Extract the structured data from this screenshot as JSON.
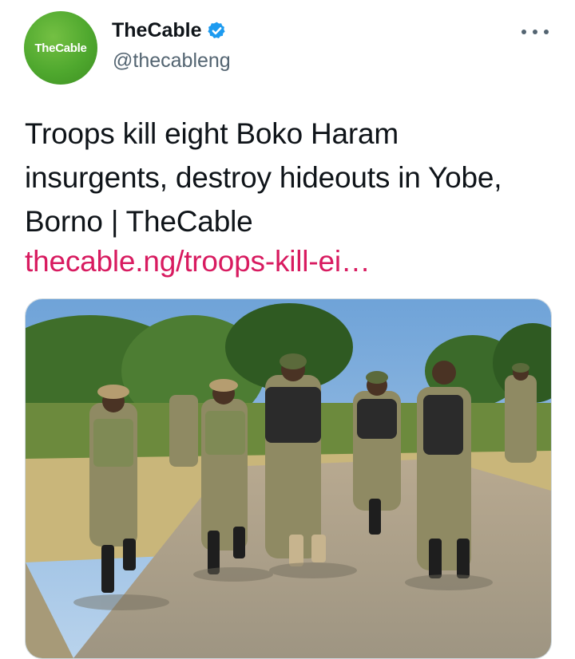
{
  "account": {
    "avatar_text": "TheCable",
    "display_name": "TheCable",
    "verified": true,
    "handle": "@thecableng"
  },
  "tweet": {
    "text": "Troops kill eight Boko Haram insurgents, destroy hideouts in Yobe, Borno | TheCable",
    "link": "thecable.ng/troops-kill-ei…"
  },
  "colors": {
    "brand_green": "#4fa82e",
    "verified_blue": "#1d9bf0",
    "link_pink": "#d81b60",
    "secondary_text": "#536471"
  },
  "icons": {
    "verified": "verified-badge-icon",
    "more": "more-options-icon"
  }
}
